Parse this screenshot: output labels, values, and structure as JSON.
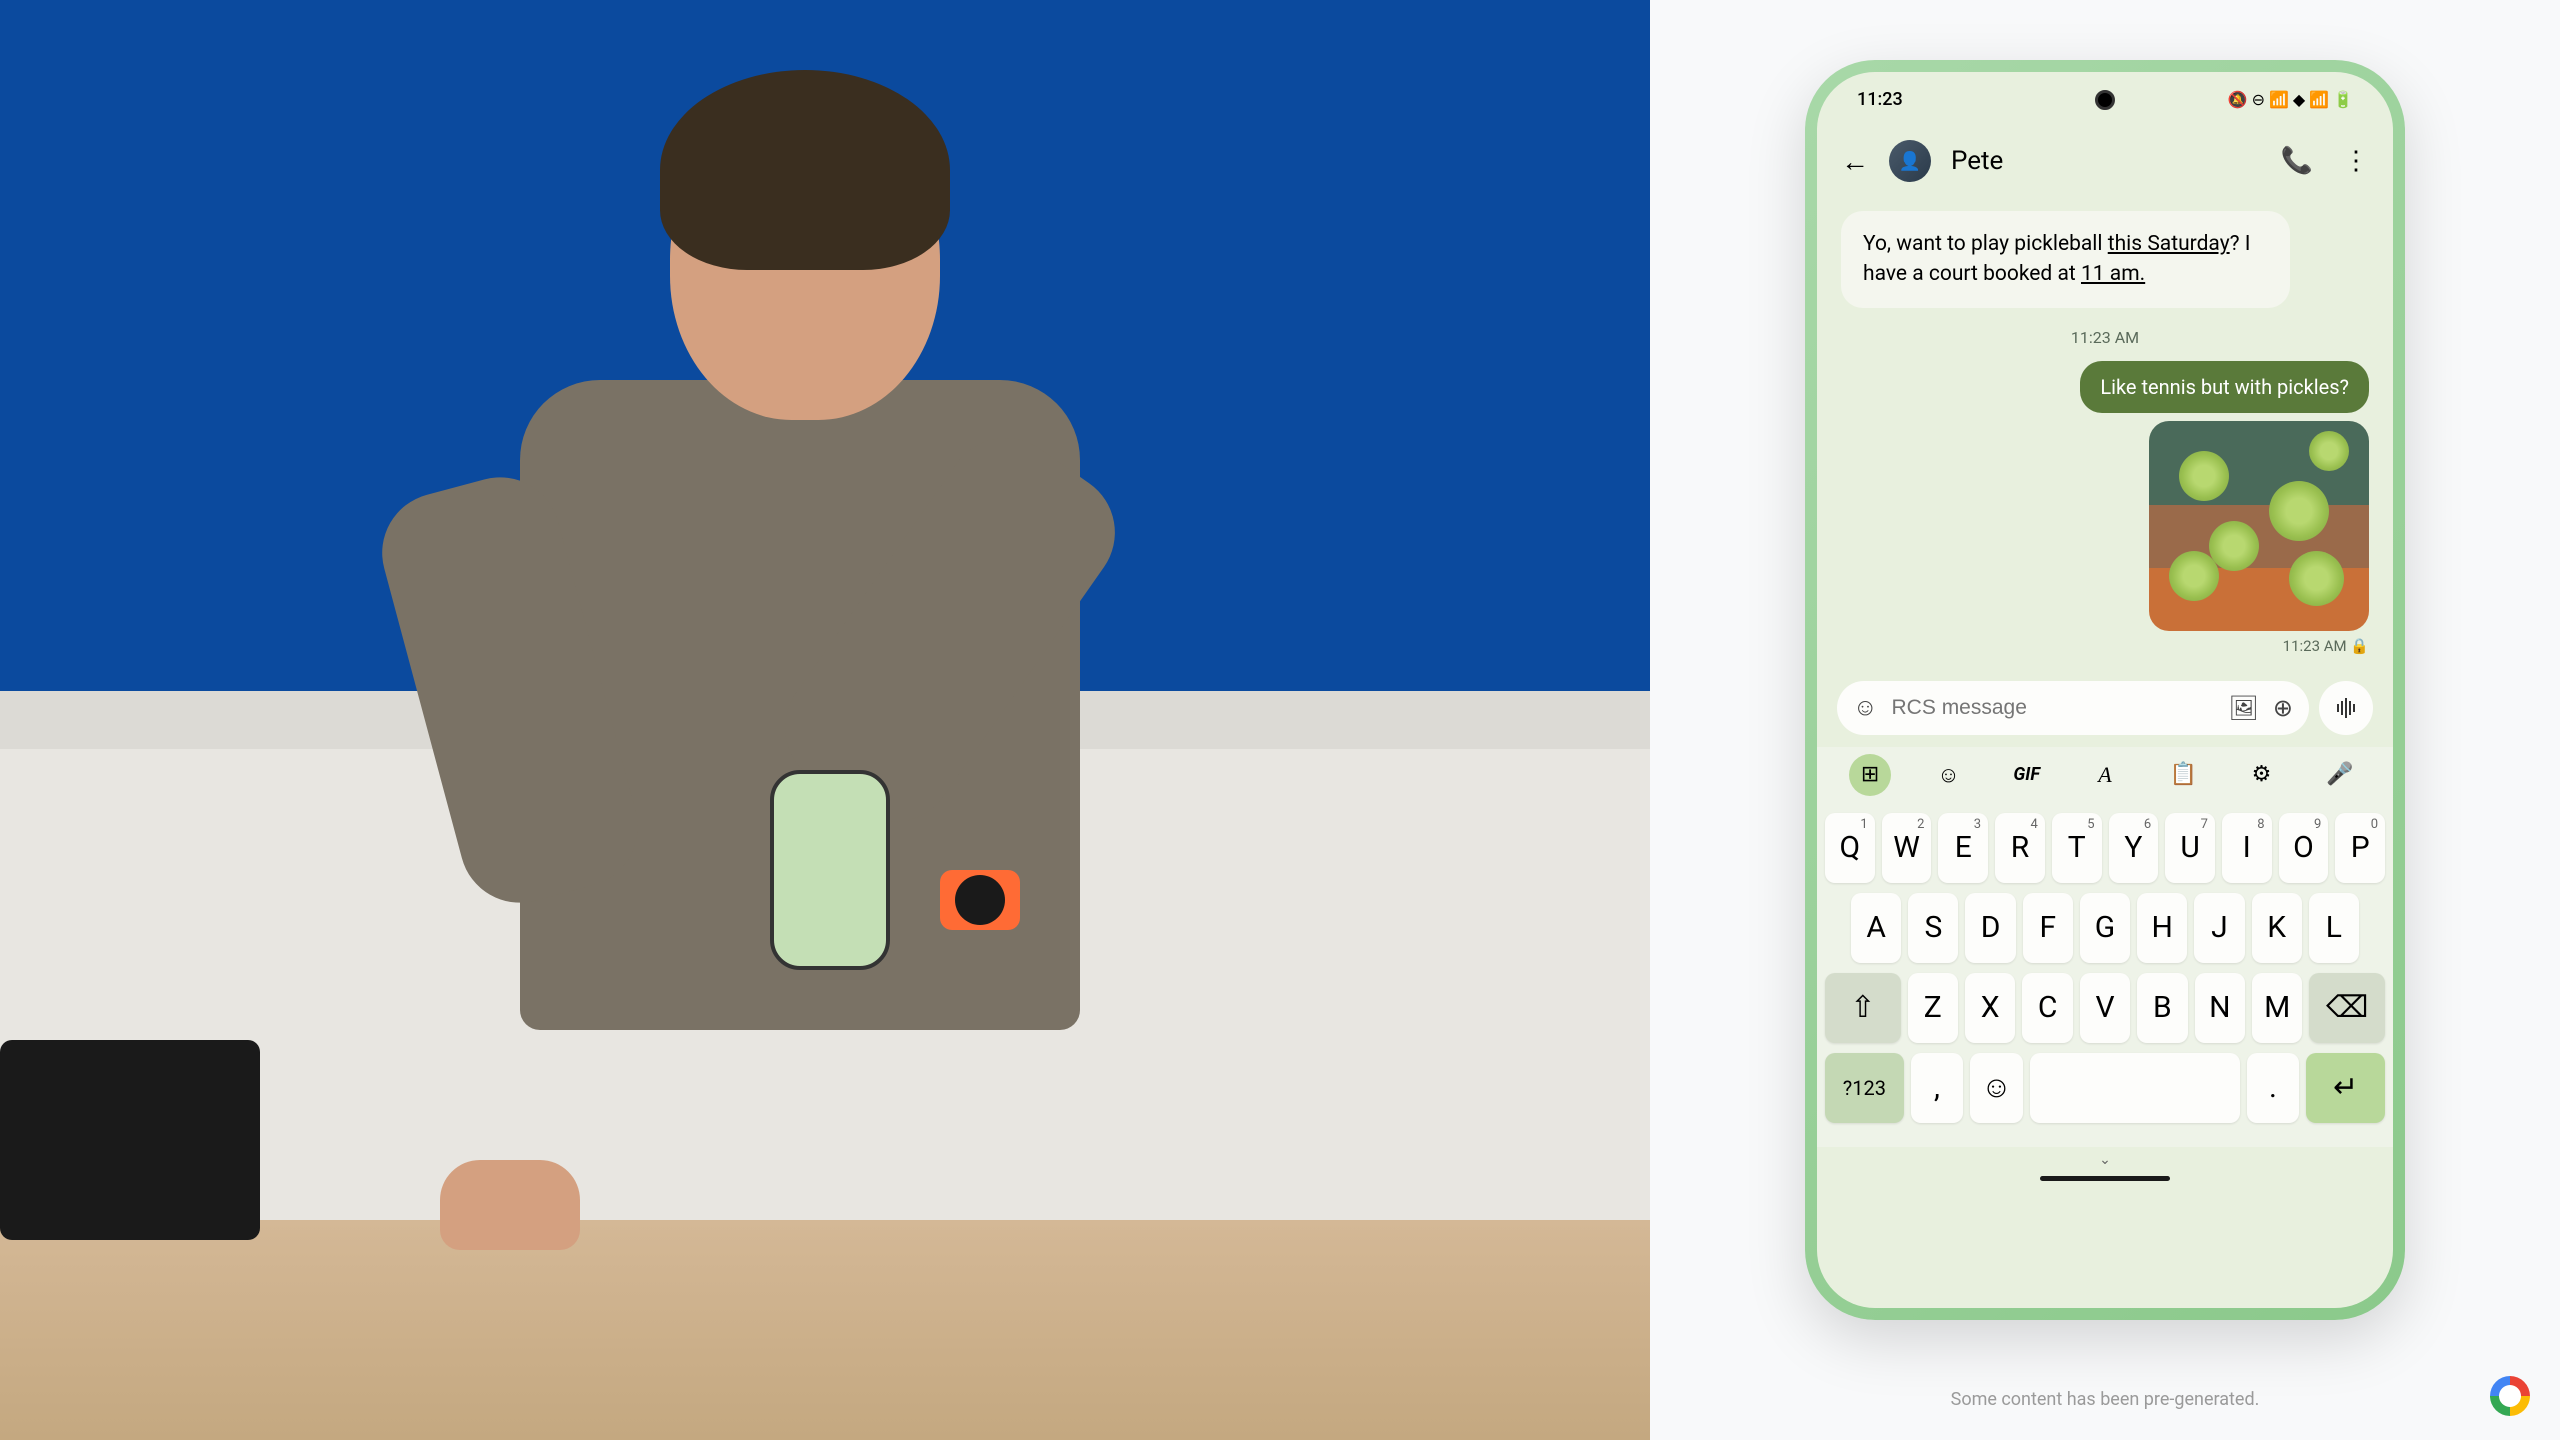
{
  "status_bar": {
    "time": "11:23"
  },
  "chat": {
    "contact_name": "Pete",
    "message_in_prefix": "Yo, want to play pickleball ",
    "message_in_underline1": "this Saturday",
    "message_in_middle": "? I have a court booked at ",
    "message_in_underline2": "11 am.",
    "timestamp_center": "11:23 AM",
    "message_out": "Like tennis but with pickles?",
    "timestamp_out": "11:23 AM  🔒"
  },
  "input": {
    "placeholder": "RCS message"
  },
  "keyboard": {
    "row1": [
      "Q",
      "W",
      "E",
      "R",
      "T",
      "Y",
      "U",
      "I",
      "O",
      "P"
    ],
    "row1_sup": [
      "1",
      "2",
      "3",
      "4",
      "5",
      "6",
      "7",
      "8",
      "9",
      "0"
    ],
    "row2": [
      "A",
      "S",
      "D",
      "F",
      "G",
      "H",
      "J",
      "K",
      "L"
    ],
    "row3": [
      "Z",
      "X",
      "C",
      "V",
      "B",
      "N",
      "M"
    ],
    "num_key": "?123",
    "comma": ",",
    "period": "."
  },
  "footer": {
    "disclaimer": "Some content has been pre-generated."
  }
}
